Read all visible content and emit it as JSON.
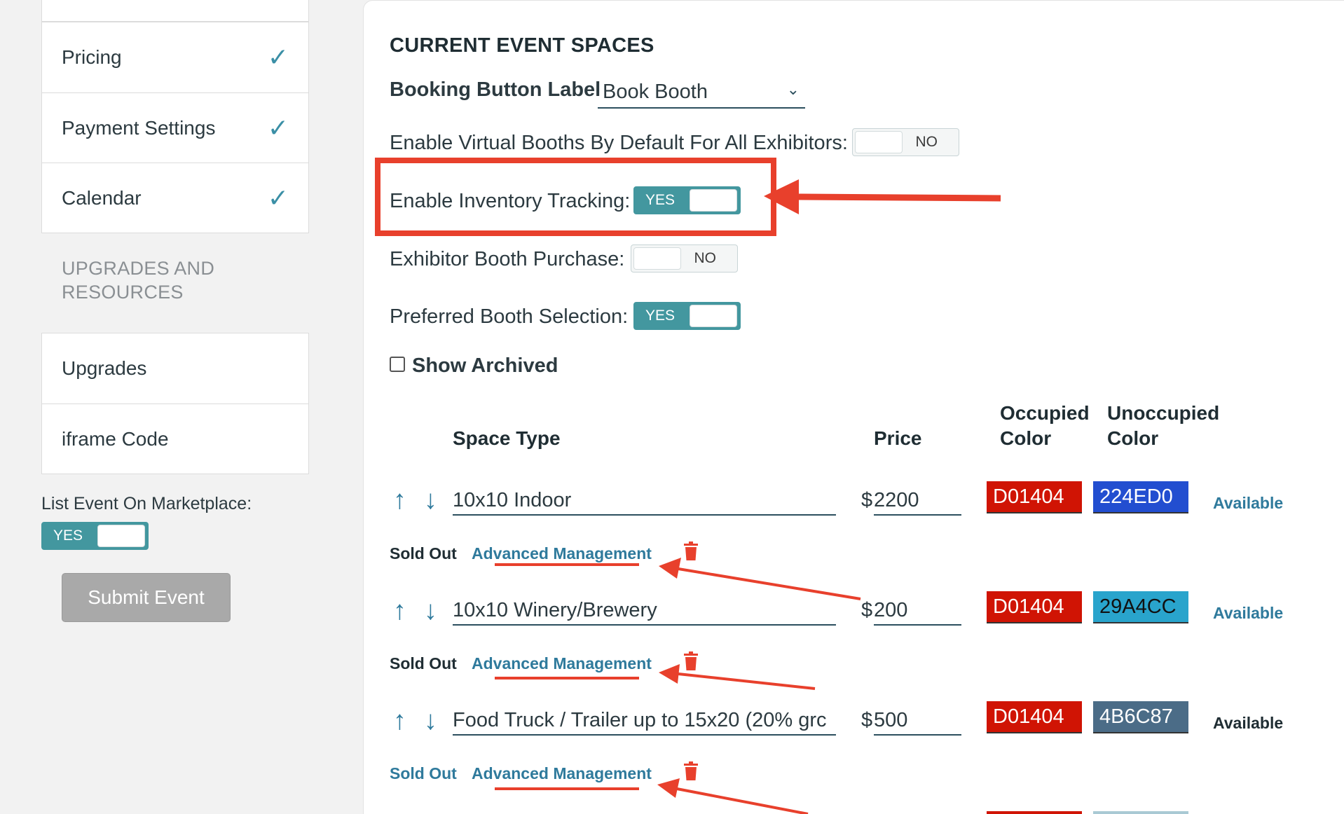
{
  "sidebar": {
    "nav_items": [
      {
        "label": "Pricing",
        "done": true
      },
      {
        "label": "Payment Settings",
        "done": true
      },
      {
        "label": "Calendar",
        "done": true
      }
    ],
    "check_glyph": "✓",
    "section_title": "UPGRADES AND RESOURCES",
    "resources": [
      {
        "label": "Upgrades"
      },
      {
        "label": "iframe Code"
      }
    ],
    "marketplace_label": "List Event On Marketplace:",
    "marketplace_toggle": "YES",
    "submit_label": "Submit Event"
  },
  "main": {
    "title": "CURRENT EVENT SPACES",
    "booking_label": "Booking Button Label",
    "booking_value": "Book Booth",
    "settings": [
      {
        "label": "Enable Virtual Booths By Default For All Exhibitors:",
        "value": "NO"
      },
      {
        "label": "Enable Inventory Tracking:",
        "value": "YES"
      },
      {
        "label": "Exhibitor Booth Purchase:",
        "value": "NO"
      },
      {
        "label": "Preferred Booth Selection:",
        "value": "YES"
      }
    ],
    "show_archived_label": "Show Archived",
    "table": {
      "headers": {
        "space_type": "Space Type",
        "price": "Price",
        "occupied_1": "Occupied",
        "occupied_2": "Color",
        "unoccupied_1": "Unoccupied",
        "unoccupied_2": "Color"
      },
      "rows": [
        {
          "space": "10x10 Indoor",
          "price_symbol": "$",
          "price": "2200",
          "occupied": "D01404",
          "unoccupied": "224ED0",
          "status": "Available",
          "sold_out": "Sold Out",
          "advanced": "Advanced Management"
        },
        {
          "space": "10x10 Winery/Brewery",
          "price_symbol": "$",
          "price": "200",
          "occupied": "D01404",
          "unoccupied": "29A4CC",
          "status": "Available",
          "sold_out": "Sold Out",
          "advanced": "Advanced Management"
        },
        {
          "space": "Food Truck / Trailer up to 15x20 (20% grc",
          "price_symbol": "$",
          "price": "500",
          "occupied": "D01404",
          "unoccupied": "4B6C87",
          "status": "Available",
          "sold_out": "Sold Out",
          "advanced": "Advanced Management"
        }
      ]
    }
  },
  "colors": {
    "accent": "#2f7a9c",
    "toggle_on": "#43979f",
    "annotation_red": "#e8402c",
    "occupied": "#D01404",
    "unoccupied_1": "#224ED0",
    "unoccupied_2": "#29A4CC",
    "unoccupied_3": "#4B6C87"
  },
  "icons": {
    "arrow_up": "↑",
    "arrow_down": "↓",
    "chevron": "⌄"
  }
}
